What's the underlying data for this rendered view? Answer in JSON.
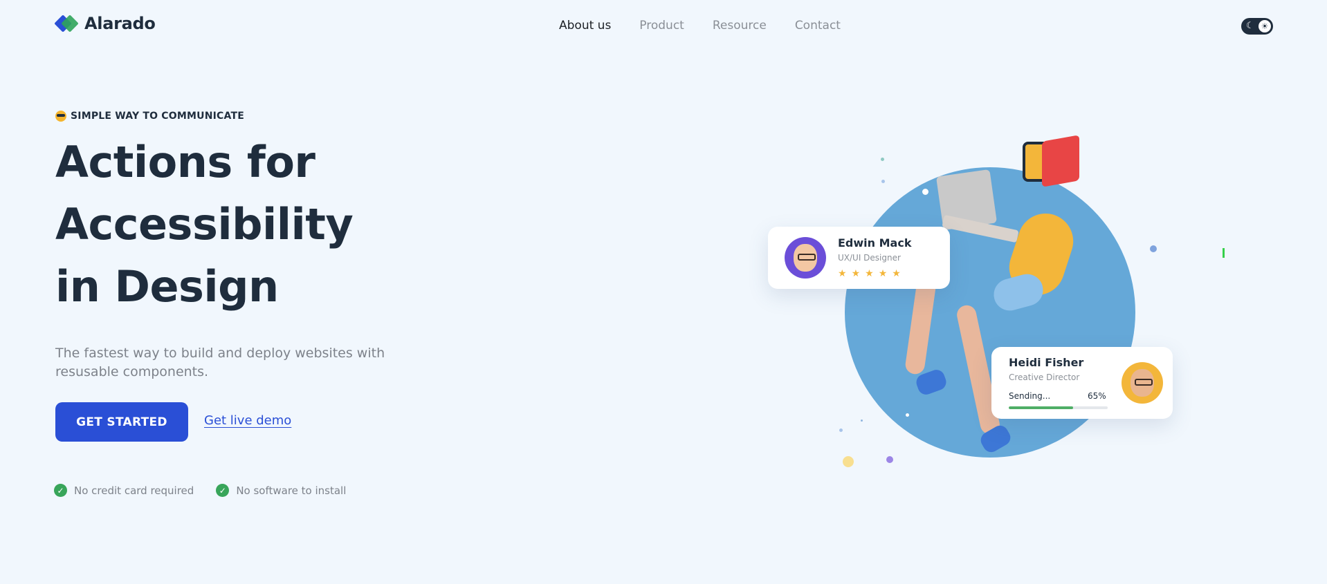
{
  "brand": {
    "name": "Alarado"
  },
  "nav": {
    "items": [
      {
        "label": "About us",
        "active": true
      },
      {
        "label": "Product",
        "active": false
      },
      {
        "label": "Resource",
        "active": false
      },
      {
        "label": "Contact",
        "active": false
      }
    ]
  },
  "theme_toggle": {
    "icons": [
      "moon-icon",
      "sun-icon"
    ]
  },
  "hero": {
    "eyebrow": "SIMPLE WAY TO COMMUNICATE",
    "headline": [
      "Actions for",
      "Accessibility",
      "in Design"
    ],
    "subtitle": "The fastest way to build and deploy websites with resusable components.",
    "cta_primary": "GET STARTED",
    "cta_secondary": "Get live demo",
    "perks": [
      "No credit card required",
      "No software to install"
    ]
  },
  "cards": {
    "edwin": {
      "name": "Edwin Mack",
      "role": "UX/UI Designer",
      "rating": 5
    },
    "heidi": {
      "name": "Heidi Fisher",
      "role": "Creative Director",
      "status": "Sending...",
      "progress_label": "65%",
      "progress": 0.65
    }
  },
  "colors": {
    "primary": "#2a4fd6",
    "success": "#38a55a",
    "heading": "#1f2d3d",
    "muted": "#7d828a",
    "circle": "#65a8d8",
    "background": "#f1f7fd"
  }
}
